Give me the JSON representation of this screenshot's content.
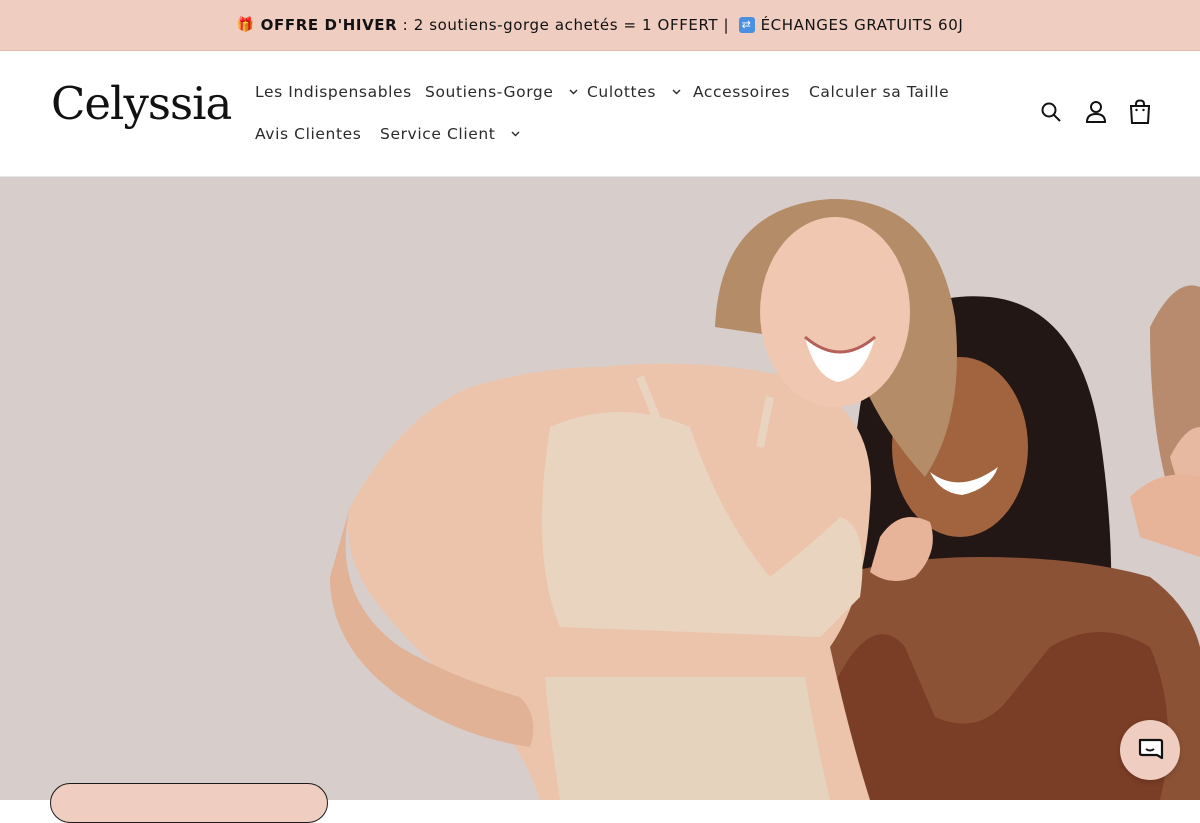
{
  "announcement": {
    "gift_icon": "gift-emoji",
    "offer_label": "OFFRE D'HIVER",
    "offer_text": " : 2 soutiens-gorge achetés = 1 OFFERT | ",
    "exchange_icon": "exchange-emoji",
    "exchange_text": "ÉCHANGES GRATUITS 60J"
  },
  "header": {
    "logo": "Celyssia",
    "nav": [
      {
        "label": "Les Indispensables",
        "has_dropdown": false
      },
      {
        "label": "Soutiens-Gorge",
        "has_dropdown": true
      },
      {
        "label": "Culottes",
        "has_dropdown": true
      },
      {
        "label": "Accessoires",
        "has_dropdown": false
      },
      {
        "label": "Calculer sa Taille",
        "has_dropdown": false
      },
      {
        "label": "Avis Clientes",
        "has_dropdown": false
      },
      {
        "label": "Service Client",
        "has_dropdown": true
      }
    ],
    "icons": [
      "search-icon",
      "account-icon",
      "cart-icon"
    ]
  },
  "hero": {
    "image": "three smiling women in seamless bras",
    "cta_label": ""
  },
  "chat": {
    "icon": "chat-bubble-icon"
  },
  "colors": {
    "accent": "#efcdc0",
    "hero_bg": "#d7cdcb",
    "text": "#121212"
  }
}
